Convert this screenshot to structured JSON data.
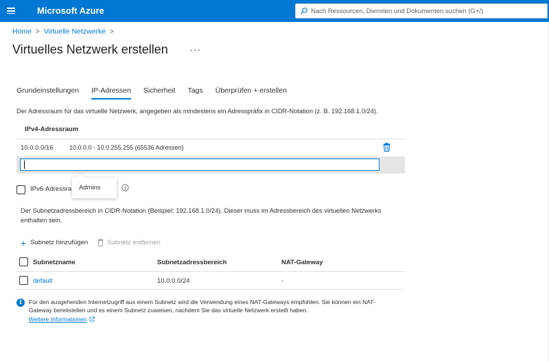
{
  "topbar": {
    "brand": "Microsoft Azure",
    "search_placeholder": "Nach Ressourcen, Diensten und Dokumenten suchen (G+/)",
    "icons": [
      "hamburger-menu-icon",
      "search-icon"
    ],
    "accent_color": "#0078d4"
  },
  "breadcrumb": {
    "items": [
      "Home",
      "Virtuelle Netzwerke"
    ],
    "separator": ">"
  },
  "page": {
    "title": "Virtuelles Netzwerk erstellen",
    "more_label": "···"
  },
  "tabs": [
    {
      "label": "Grundeinstellungen",
      "active": false
    },
    {
      "label": "IP-Adressen",
      "active": true
    },
    {
      "label": "Sicherheit",
      "active": false
    },
    {
      "label": "Tags",
      "active": false
    },
    {
      "label": "Überprüfen + erstellen",
      "active": false
    }
  ],
  "ip_section": {
    "description": "Der Adressraum für das virtuelle Netzwerk, angegeben als mindestens ein Adresspräfix in CIDR-Notation (z. B. 192.168.1.0/24).",
    "ipv4_header": "IPv4-Adressraum",
    "ipv4_rows": [
      {
        "address": "10.0.0.0/16",
        "range": "10.0.0.0 - 10.0.255.255 (65536 Adressen)"
      }
    ],
    "new_address_value": "",
    "ipv6_label": "IPv6-Adressra",
    "ipv6_checked": false,
    "tooltip_text": "Admins"
  },
  "subnet_section": {
    "description": "Der Subnetzadressbereich in CIDR-Notation (Beispiel: 192.168.1.0/24). Dieser muss im Adressbereich des virtuellen Netzwerks enthalten sein.",
    "add_label": "Subnetz hinzufügen",
    "remove_label": "Subnetz entfernen",
    "columns": [
      "Subnetzname",
      "Subnetzadressbereich",
      "NAT-Gateway"
    ],
    "rows": [
      {
        "name": "default",
        "range": "10.0.0.0/24",
        "nat": "-"
      }
    ]
  },
  "info_banner": {
    "text": "Für den ausgehenden Internetzugriff aus einem Subnetz wird die Verwendung eines NAT-Gateways empfohlen. Sie können ein NAT-Gateway bereitstellen und es einem Subnetz zuweisen, nachdem Sie das virtuelle Netzwerk erstellt haben.",
    "link_label": "Weitere Informationen"
  }
}
